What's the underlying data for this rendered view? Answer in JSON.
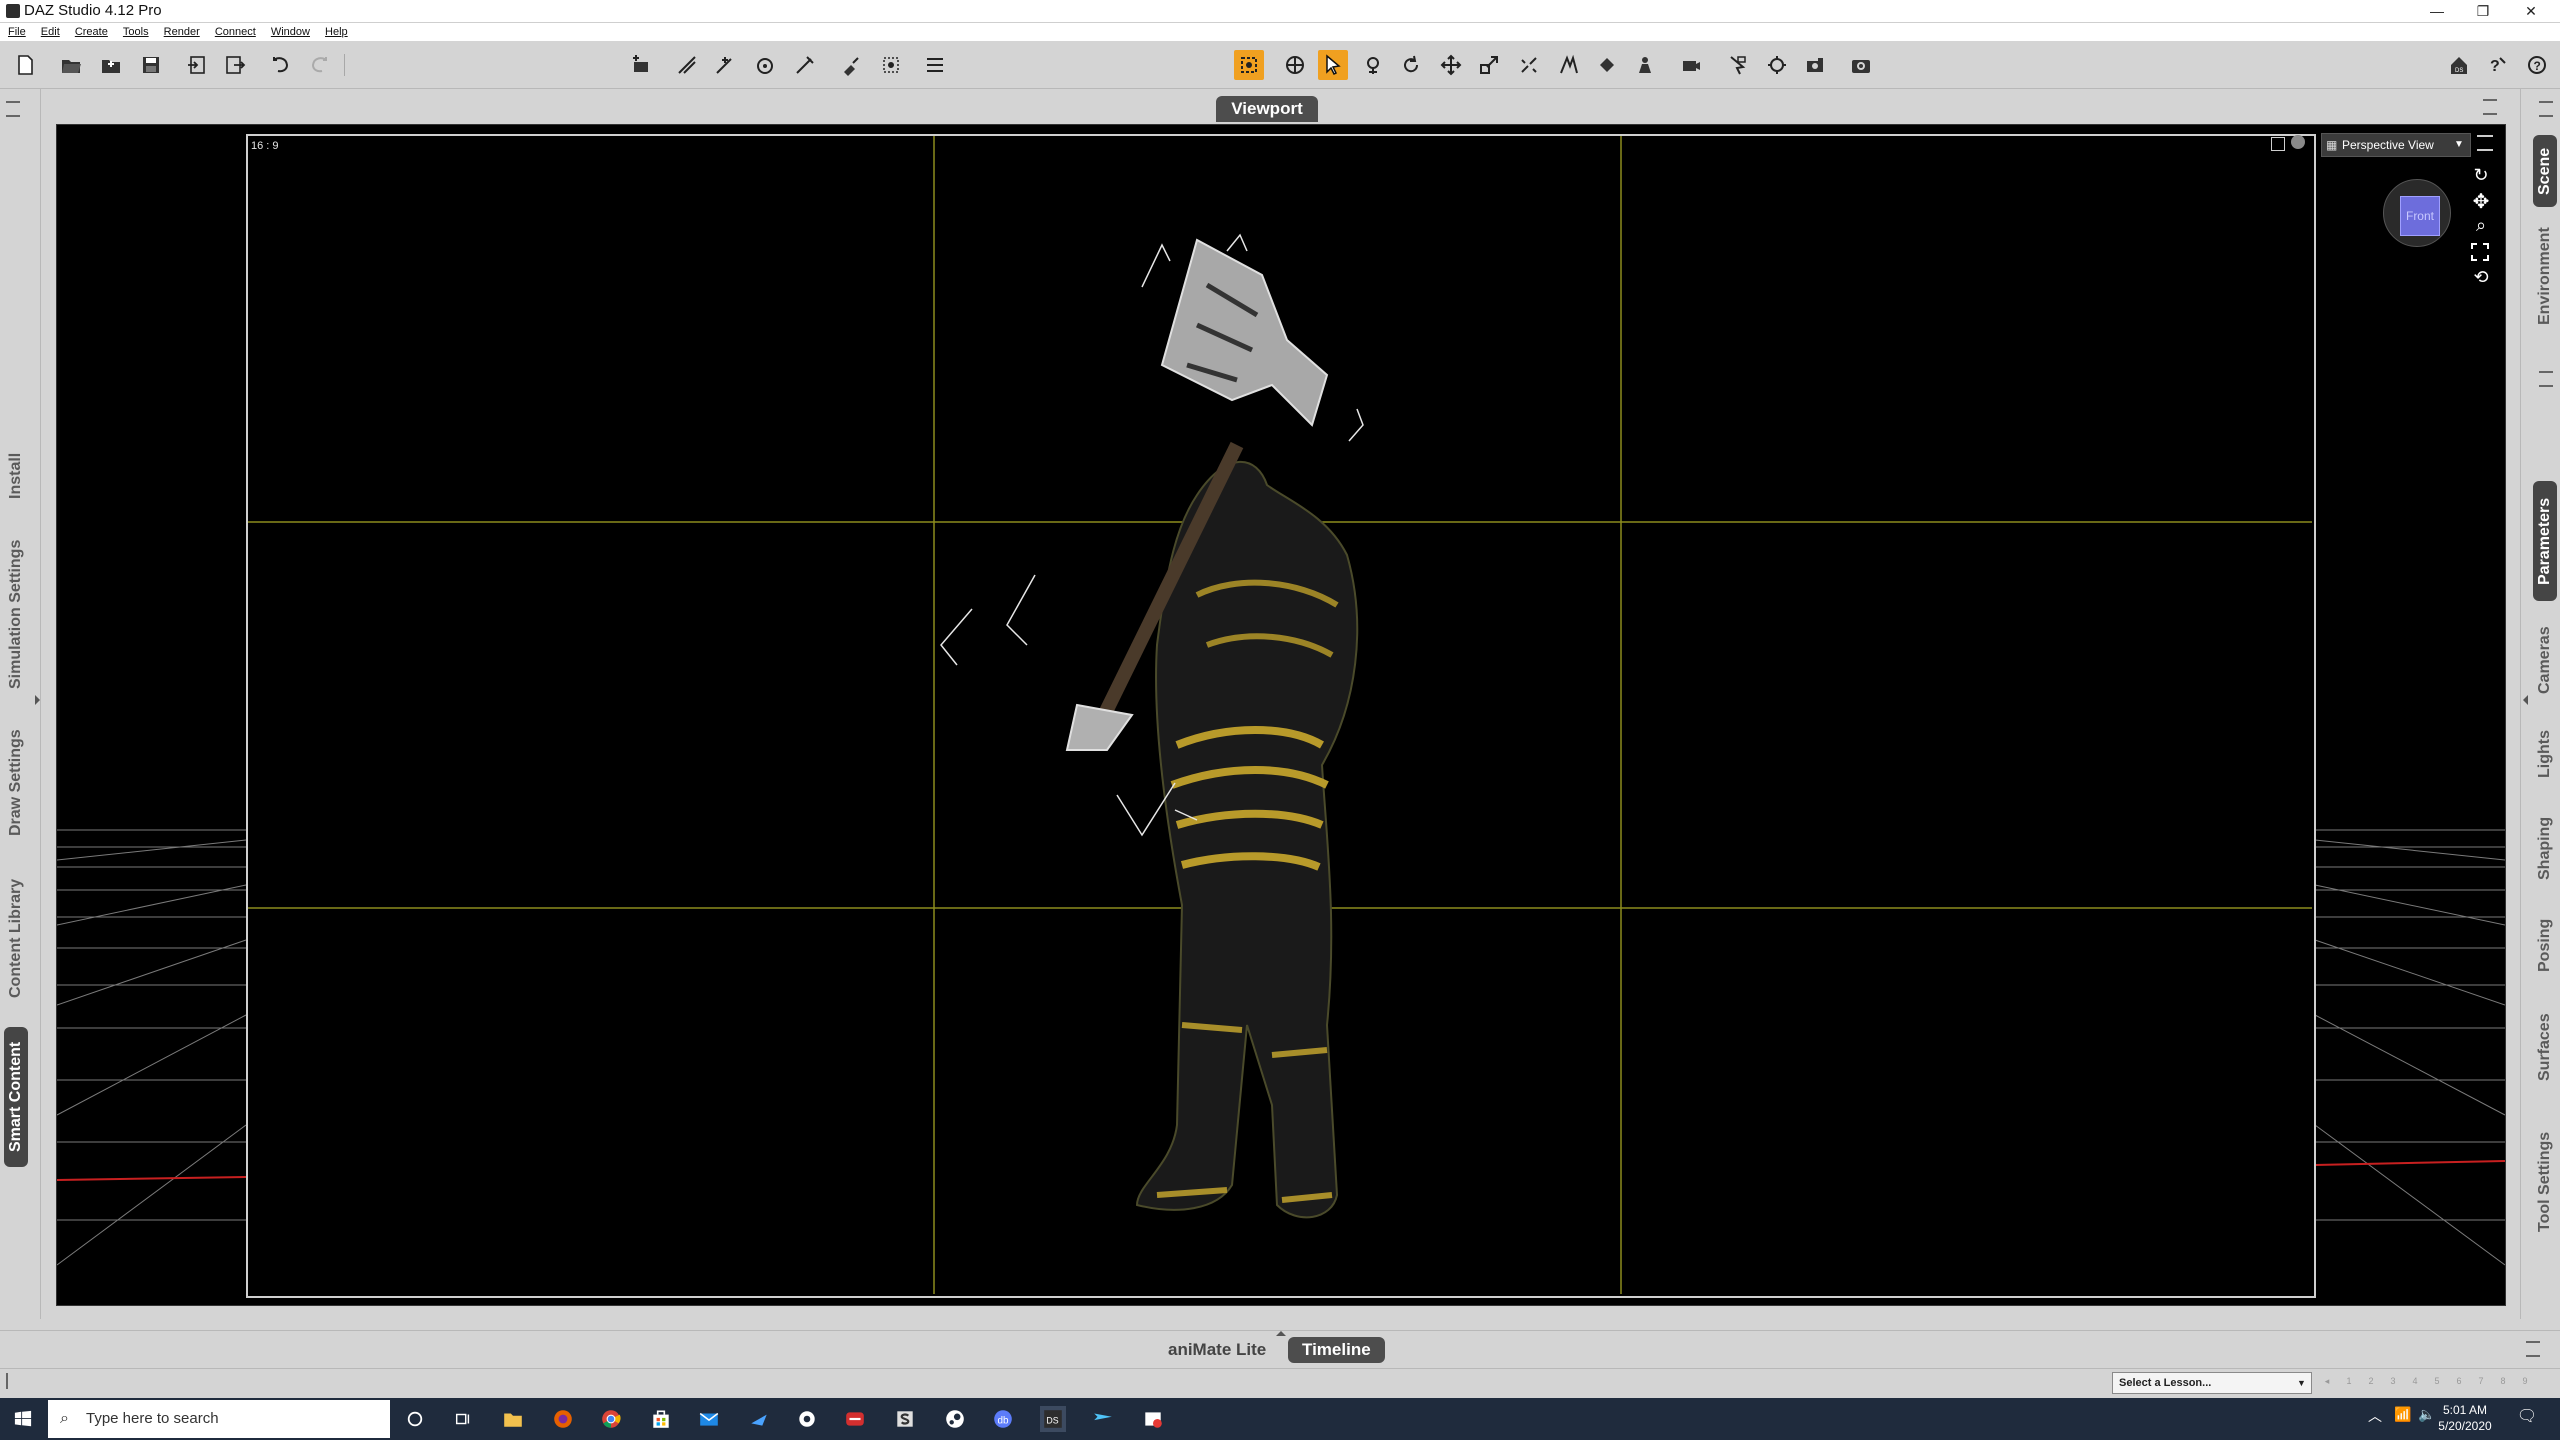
{
  "window": {
    "title": "DAZ Studio 4.12 Pro",
    "minimize": "—",
    "maximize": "❐",
    "close": "✕"
  },
  "menu": [
    "File",
    "Edit",
    "Create",
    "Tools",
    "Render",
    "Connect",
    "Window",
    "Help"
  ],
  "viewport": {
    "tab_label": "Viewport",
    "aspect_label": "16 : 9",
    "view_selector": "Perspective View",
    "viewcube_label": "Front"
  },
  "left_tabs": [
    "Install",
    "Simulation Settings",
    "Draw Settings",
    "Content Library",
    "Smart Content"
  ],
  "left_active": "Smart Content",
  "right_tabs": [
    "Scene",
    "Environment",
    "Parameters",
    "Cameras",
    "Lights",
    "Shaping",
    "Posing",
    "Surfaces",
    "Tool Settings"
  ],
  "right_active": [
    "Scene",
    "Parameters"
  ],
  "bottom_tabs": [
    "aniMate Lite",
    "Timeline"
  ],
  "bottom_active": "Timeline",
  "lesson_select": "Select a Lesson...",
  "lesson_steps": [
    "1",
    "2",
    "3",
    "4",
    "5",
    "6",
    "7",
    "8",
    "9"
  ],
  "taskbar": {
    "search_placeholder": "Type here to search",
    "time": "5:01 AM",
    "date": "5/20/2020"
  },
  "colors": {
    "accent": "#f0a020",
    "panel_bg": "#d4d4d4",
    "viewport_bg": "#000000",
    "taskbar_bg": "#1f2b3d",
    "guide_line": "#8c8c1e"
  }
}
